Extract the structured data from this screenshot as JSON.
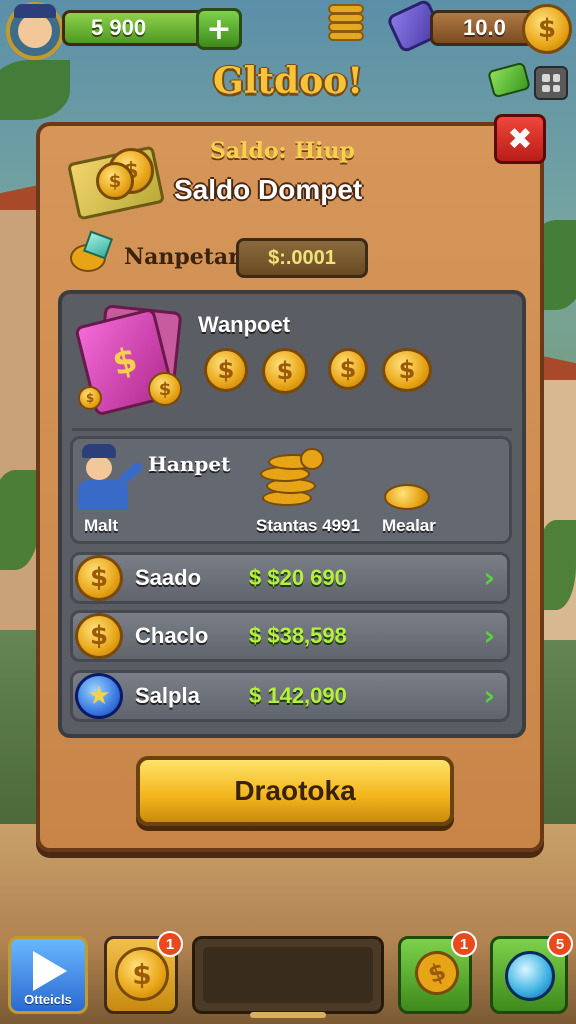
{
  "hud": {
    "money": "5 900",
    "plus": "+",
    "gems": "10.0",
    "coin_symbol": "$"
  },
  "title": "Gltdoo!",
  "panel": {
    "close": "✖",
    "subtitle": "Saldo: Hiup",
    "heading": "Saldo Dompet",
    "balance_label": "Nanpetar",
    "balance_value": "$:.0001",
    "section1_title": "Wanpoet",
    "section2": {
      "title": "Hanpet",
      "labels": [
        "Malt",
        "Stantas 4991",
        "Mealar"
      ]
    },
    "rows": [
      {
        "label": "Saado",
        "value": "$ $20 690",
        "icon": "dollar-coin-icon"
      },
      {
        "label": "Chaclo",
        "value": "$ $38,598",
        "icon": "dollar-coin-icon"
      },
      {
        "label": "Salpla",
        "value": "$ 142,090",
        "icon": "star-coin-icon"
      }
    ],
    "action_button": "Draotoka"
  },
  "bottom": {
    "play_label": "Otteicls",
    "coin_badge": "1",
    "green_badge": "1",
    "globe_badge": "5"
  },
  "colors": {
    "panel": "#d6965a",
    "action": "#f2b41a",
    "value_green": "#b6f03a",
    "close_red": "#e0362c"
  }
}
